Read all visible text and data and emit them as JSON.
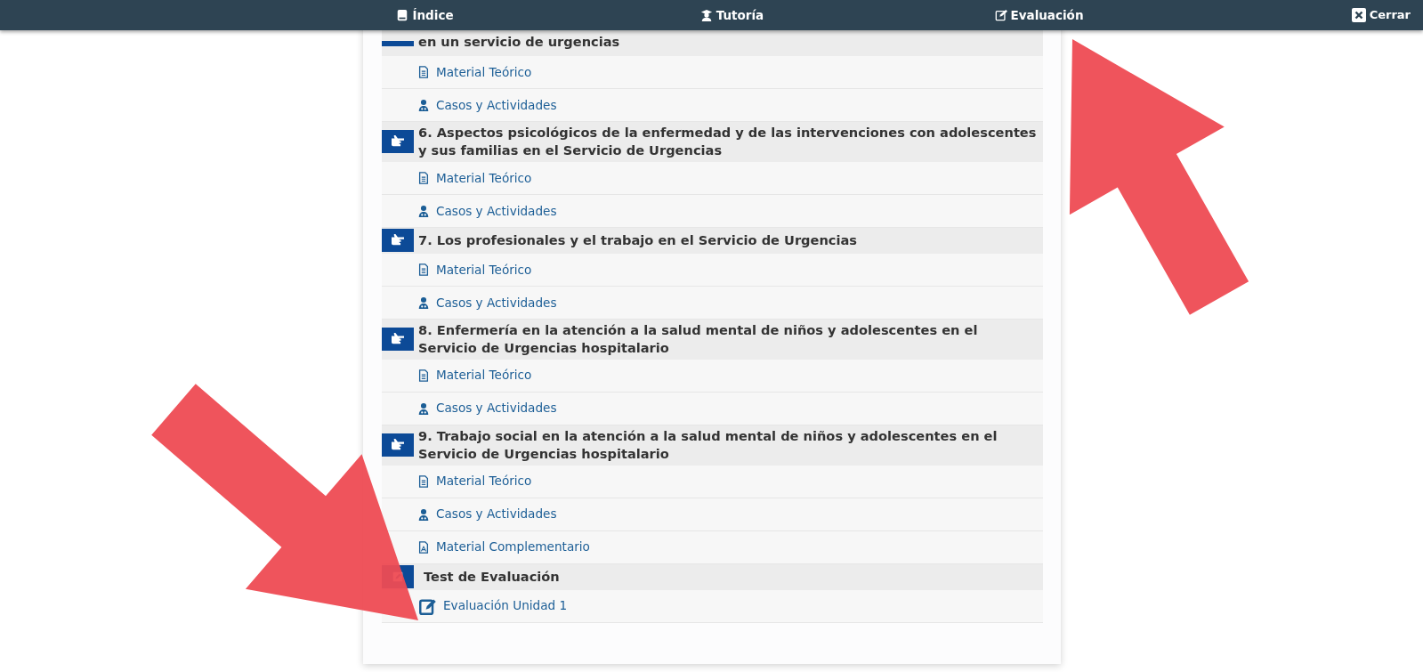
{
  "navbar": {
    "items": [
      {
        "label": "Índice",
        "kind": "index"
      },
      {
        "label": "Tutoría",
        "kind": "tutor"
      },
      {
        "label": "Evaluación",
        "kind": "evaluation"
      }
    ],
    "close": {
      "label": "Cerrar"
    }
  },
  "sections": [
    {
      "title": "en un servicio de urgencias",
      "kind": "unit",
      "items": [
        {
          "label": "Material Teórico",
          "kind": "theory"
        },
        {
          "label": "Casos y Actividades",
          "kind": "cases"
        }
      ]
    },
    {
      "title": "6. Aspectos psicológicos de la enfermedad y de las intervenciones con adolescentes y sus familias en el Servicio de Urgencias",
      "kind": "unit",
      "items": [
        {
          "label": "Material Teórico",
          "kind": "theory"
        },
        {
          "label": "Casos y Actividades",
          "kind": "cases"
        }
      ]
    },
    {
      "title": "7. Los profesionales y el trabajo en el Servicio de Urgencias",
      "kind": "unit",
      "items": [
        {
          "label": "Material Teórico",
          "kind": "theory"
        },
        {
          "label": "Casos y Actividades",
          "kind": "cases"
        }
      ]
    },
    {
      "title": "8. Enfermería en la atención a la salud mental de niños y adolescentes en el Servicio de Urgencias hospitalario",
      "kind": "unit",
      "items": [
        {
          "label": "Material Teórico",
          "kind": "theory"
        },
        {
          "label": "Casos y Actividades",
          "kind": "cases"
        }
      ]
    },
    {
      "title": "9. Trabajo social en la atención a la salud mental de niños y adolescentes en el Servicio de Urgencias hospitalario",
      "kind": "unit",
      "items": [
        {
          "label": "Material Teórico",
          "kind": "theory"
        },
        {
          "label": "Casos y Actividades",
          "kind": "cases"
        },
        {
          "label": "Material Complementario",
          "kind": "complement"
        }
      ]
    },
    {
      "title": "Test de Evaluación",
      "kind": "test",
      "items": [
        {
          "label": "Evaluación Unidad 1",
          "kind": "evaluation"
        }
      ]
    }
  ]
}
